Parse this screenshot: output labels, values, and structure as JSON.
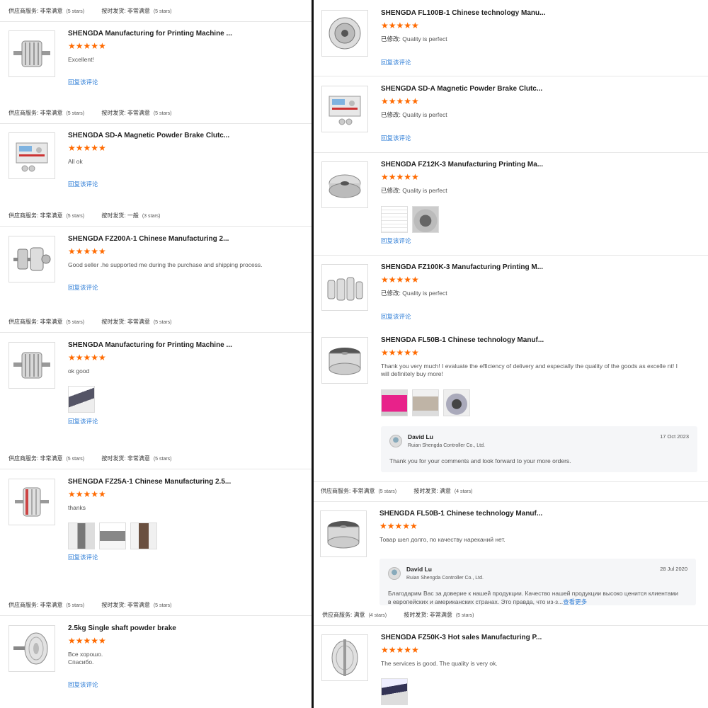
{
  "labels": {
    "supplier": "供应商服务:",
    "shipping": "按时发货:",
    "reply": "回复该评论",
    "edited": "已修改:",
    "very_satisfied": "非常满意",
    "satisfied": "满意",
    "average": "一般",
    "five_stars": "(5 stars)",
    "four_stars": "(4 stars)",
    "three_stars": "(3 stars)",
    "see_more": "查看更多"
  },
  "star_icon": "★★★★★",
  "accent_color": "#ff6a00",
  "link_color": "#2a7bd6",
  "left": {
    "meta": [
      {
        "supplier_value": "非常满意",
        "supplier_stars": "(5 stars)",
        "shipping_value": "非常满意",
        "shipping_stars": "(5 stars)"
      },
      {
        "supplier_value": "非常满意",
        "supplier_stars": "(5 stars)",
        "shipping_value": "非常满意",
        "shipping_stars": "(5 stars)"
      },
      {
        "supplier_value": "非常满意",
        "supplier_stars": "(5 stars)",
        "shipping_value": "一般",
        "shipping_stars": "(3 stars)"
      },
      {
        "supplier_value": "非常满意",
        "supplier_stars": "(5 stars)",
        "shipping_value": "非常满意",
        "shipping_stars": "(5 stars)"
      },
      {
        "supplier_value": "非常满意",
        "supplier_stars": "(5 stars)",
        "shipping_value": "非常满意",
        "shipping_stars": "(5 stars)"
      },
      {
        "supplier_value": "非常满意",
        "supplier_stars": "(5 stars)",
        "shipping_value": "非常满意",
        "shipping_stars": "(5 stars)"
      }
    ],
    "reviews": [
      {
        "title": "SHENGDA Manufacturing for Printing Machine ...",
        "rating": 5,
        "text": "Excellent!"
      },
      {
        "title": "SHENGDA SD-A Magnetic Powder Brake Clutc...",
        "rating": 5,
        "text": "All ok"
      },
      {
        "title": "SHENGDA FZ200A-1 Chinese Manufacturing 2...",
        "rating": 5,
        "text": "Good seller .he supported me during the purchase and shipping process."
      },
      {
        "title": "SHENGDA Manufacturing for Printing Machine ...",
        "rating": 5,
        "text": "ok good"
      },
      {
        "title": "SHENGDA FZ25A-1 Chinese Manufacturing 2.5...",
        "rating": 5,
        "text": "thanks"
      },
      {
        "title": "2.5kg Single shaft powder brake",
        "rating": 5,
        "text_line1": "Все хорошо.",
        "text_line2": "Спасибо."
      }
    ]
  },
  "right": {
    "reviews": [
      {
        "title": "SHENGDA FL100B-1 Chinese technology Manu...",
        "rating": 5,
        "text": "Quality is perfect"
      },
      {
        "title": "SHENGDA SD-A Magnetic Powder Brake Clutc...",
        "rating": 5,
        "text": "Quality is perfect"
      },
      {
        "title": "SHENGDA FZ12K-3 Manufacturing Printing Ma...",
        "rating": 5,
        "text": "Quality is perfect"
      },
      {
        "title": "SHENGDA FZ100K-3 Manufacturing Printing M...",
        "rating": 5,
        "text": "Quality is perfect"
      },
      {
        "title": "SHENGDA FL50B-1 Chinese technology Manuf...",
        "rating": 5,
        "text": "Thank you very much! I evaluate the efficiency of delivery and especially the quality of the goods as excelle nt! I will definitely buy more!"
      },
      {
        "title": "SHENGDA FL50B-1 Chinese technology Manuf...",
        "rating": 5,
        "text": "Товар шел долго, по качеству нареканий нет."
      },
      {
        "title": "SHENGDA FZ50K-3 Hot sales Manufacturing P...",
        "rating": 5,
        "text": "The services is good. The quality is very ok."
      }
    ],
    "seller_replies": [
      {
        "name": "David Lu",
        "company": "Ruian Shengda Controller Co., Ltd.",
        "date": "17 Oct 2023",
        "message": "Thank you for your comments and look forward to your more orders."
      },
      {
        "name": "David Lu",
        "company": "Ruian Shengda Controller Co., Ltd.",
        "date": "28 Jul 2020",
        "message": "Благодарим Вас за доверие к нашей продукции. Качество нашей продукции высоко ценится клиентами в европейских и американских странах. Это правда, что из-з..."
      }
    ],
    "meta": [
      {
        "supplier_value": "非常满意",
        "supplier_stars": "(5 stars)",
        "shipping_value": "满意",
        "shipping_stars": "(4 stars)"
      },
      {
        "supplier_value": "满意",
        "supplier_stars": "(4 stars)",
        "shipping_value": "非常满意",
        "shipping_stars": "(5 stars)"
      }
    ]
  }
}
